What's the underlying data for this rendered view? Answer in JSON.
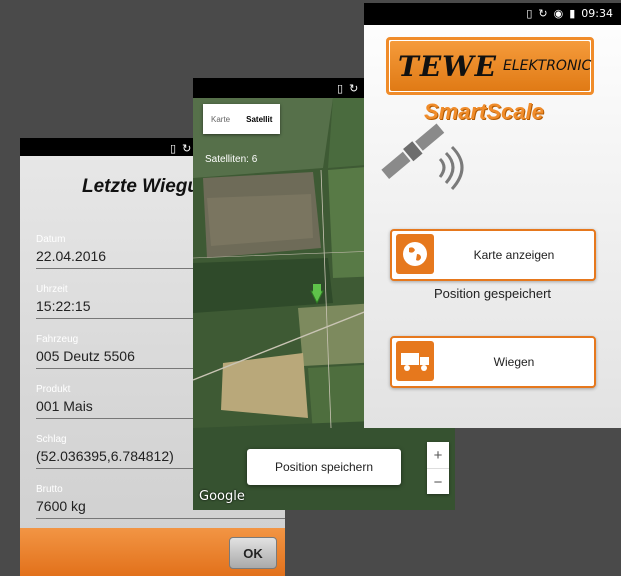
{
  "phone1": {
    "title": "Letzte Wiegu",
    "fields": [
      {
        "label": "Datum",
        "value": "22.04.2016"
      },
      {
        "label": "Uhrzeit",
        "value": "15:22:15"
      },
      {
        "label": "Fahrzeug",
        "value": "005 Deutz 5506"
      },
      {
        "label": "Produkt",
        "value": "001 Mais"
      },
      {
        "label": "Schlag",
        "value": "(52.036395,6.784812)"
      },
      {
        "label": "Brutto",
        "value": "7600 kg"
      }
    ],
    "ok_label": "OK"
  },
  "phone2": {
    "map_tabs": {
      "karte": "Karte",
      "satellit": "Satellit"
    },
    "satellites_text": "Satelliten: 6",
    "save_position_label": "Position speichern",
    "zoom_in": "+",
    "zoom_out": "−",
    "google": "Google"
  },
  "phone3": {
    "time": "09:34",
    "logo_brand": "TEWE",
    "logo_sub": "ELEKTRONIC",
    "app_name": "SmartScale",
    "map_button_label": "Karte anzeigen",
    "position_status": "Position gespeichert",
    "weigh_button_label": "Wiegen"
  },
  "colors": {
    "accent": "#e6781d",
    "background": "#4a4a4a"
  },
  "icons": [
    "sim-icon",
    "rotate-icon",
    "wifi-icon",
    "battery-icon",
    "globe-icon",
    "truck-icon",
    "satellite-icon",
    "location-pin-icon"
  ]
}
